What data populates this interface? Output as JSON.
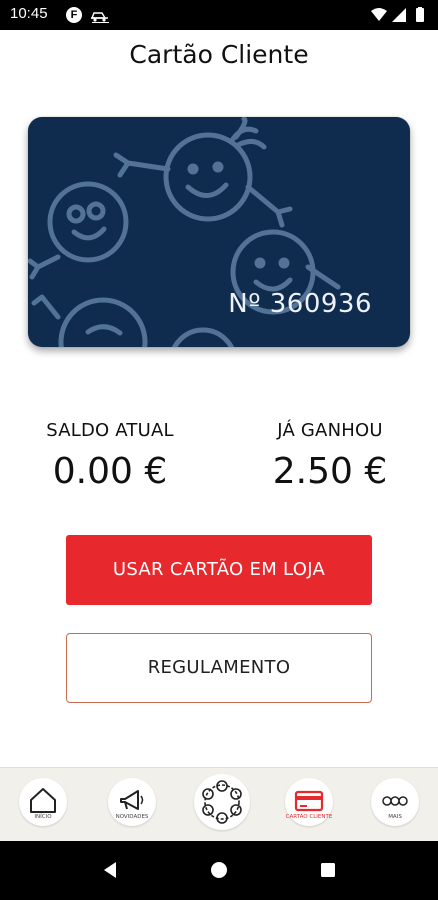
{
  "status_bar": {
    "time": "10:45",
    "app_icon_letter": "F",
    "icons": [
      "app-notification-icon",
      "car-icon",
      "wifi-icon",
      "signal-icon",
      "battery-icon"
    ]
  },
  "header": {
    "title": "Cartão Cliente"
  },
  "card": {
    "number": "Nº 360936",
    "background_color": "#0f2c4f"
  },
  "balance": {
    "current_label": "SALDO ATUAL",
    "current_value": "0.00 €",
    "earned_label": "JÁ GANHOU",
    "earned_value": "2.50 €"
  },
  "actions": {
    "use_card_label": "USAR CARTÃO EM LOJA",
    "rules_label": "REGULAMENTO",
    "primary_color": "#e7282d"
  },
  "bottom_nav": {
    "items": [
      {
        "label": "INÍCIO",
        "icon": "home-icon"
      },
      {
        "label": "NOVIDADES",
        "icon": "megaphone-icon"
      },
      {
        "label": "",
        "icon": "faces-logo-icon"
      },
      {
        "label": "CARTÃO CLIENTE",
        "icon": "credit-card-icon",
        "active": true
      },
      {
        "label": "MAIS",
        "icon": "more-icon"
      }
    ]
  },
  "system_nav": {
    "icons": [
      "back-icon",
      "home-circle-icon",
      "recents-icon"
    ]
  }
}
